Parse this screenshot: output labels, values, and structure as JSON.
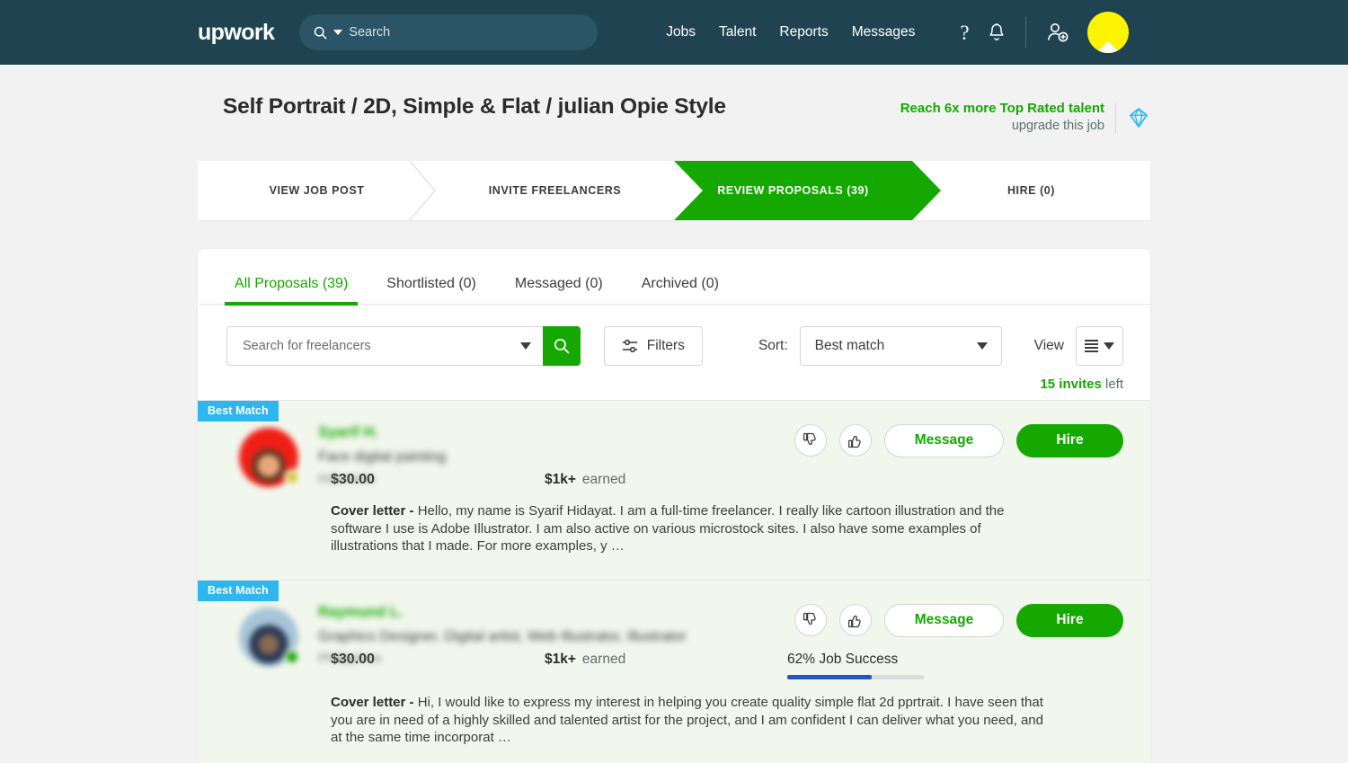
{
  "nav": {
    "logo": "upwork",
    "search_placeholder": "Search",
    "search_value": "",
    "links": [
      "Jobs",
      "Talent",
      "Reports",
      "Messages"
    ],
    "help_glyph": "?",
    "icons": [
      "help-icon",
      "notifications-bell-icon",
      "invite-person-icon",
      "user-avatar"
    ]
  },
  "header": {
    "job_title": "Self Portrait / 2D, Simple & Flat / julian Opie Style",
    "upgrade_link": "Reach 6x more Top Rated talent",
    "upgrade_sub": "upgrade this job",
    "accent_green": "#14a800"
  },
  "steps": [
    {
      "label": "VIEW JOB POST",
      "active": false
    },
    {
      "label": "INVITE FREELANCERS",
      "active": false
    },
    {
      "label": "REVIEW PROPOSALS (39)",
      "active": true
    },
    {
      "label": "HIRE (0)",
      "active": false
    }
  ],
  "tabs": [
    {
      "label": "All Proposals (39)",
      "active": true
    },
    {
      "label": "Shortlisted (0)",
      "active": false
    },
    {
      "label": "Messaged (0)",
      "active": false
    },
    {
      "label": "Archived (0)",
      "active": false
    }
  ],
  "toolbar": {
    "search_placeholder": "Search for freelancers",
    "search_value": "",
    "filters_label": "Filters",
    "sort_label": "Sort:",
    "sort_value": "Best match",
    "view_label": "View",
    "invites_count": "15 invites",
    "invites_suffix": "left"
  },
  "proposals": [
    {
      "badge": "Best Match",
      "name": "Syarif H.",
      "role": "Face digital painting",
      "location": "Indonesia",
      "rate": "$30.00",
      "earned_amount": "$1k+",
      "earned_label": "earned",
      "job_success": null,
      "job_success_label": null,
      "status": "away",
      "message_label": "Message",
      "hire_label": "Hire",
      "cover_prefix": "Cover letter - ",
      "cover_text": "Hello, my name is Syarif Hidayat. I am a full-time freelancer. I really like cartoon illustration and the software I use is Adobe Illustrator. I am also active on various microstock sites. I also have some examples of illustrations that I made. For more examples, y …"
    },
    {
      "badge": "Best Match",
      "name": "Raymund L.",
      "role": "Graphics Designer, Digital artist, Web Illustrator, Illustrator",
      "location": "Philippines",
      "rate": "$30.00",
      "earned_amount": "$1k+",
      "earned_label": "earned",
      "job_success": 62,
      "job_success_label": "62% Job Success",
      "status": "online",
      "message_label": "Message",
      "hire_label": "Hire",
      "cover_prefix": "Cover letter - ",
      "cover_text": "Hi, I would like to express my interest in helping you create quality simple flat 2d pprtrait. I have seen that you are in need of a highly skilled and talented artist for the project, and I am confident I can deliver what you need, and at the same time incorporat …"
    }
  ],
  "colors": {
    "nav_bg": "#1f4351",
    "green": "#14a800",
    "badge_blue": "#2eb6ee",
    "jss_blue": "#1f57c3",
    "avatar_yellow": "#fcf400",
    "card_bg": "#f2f7ed"
  }
}
